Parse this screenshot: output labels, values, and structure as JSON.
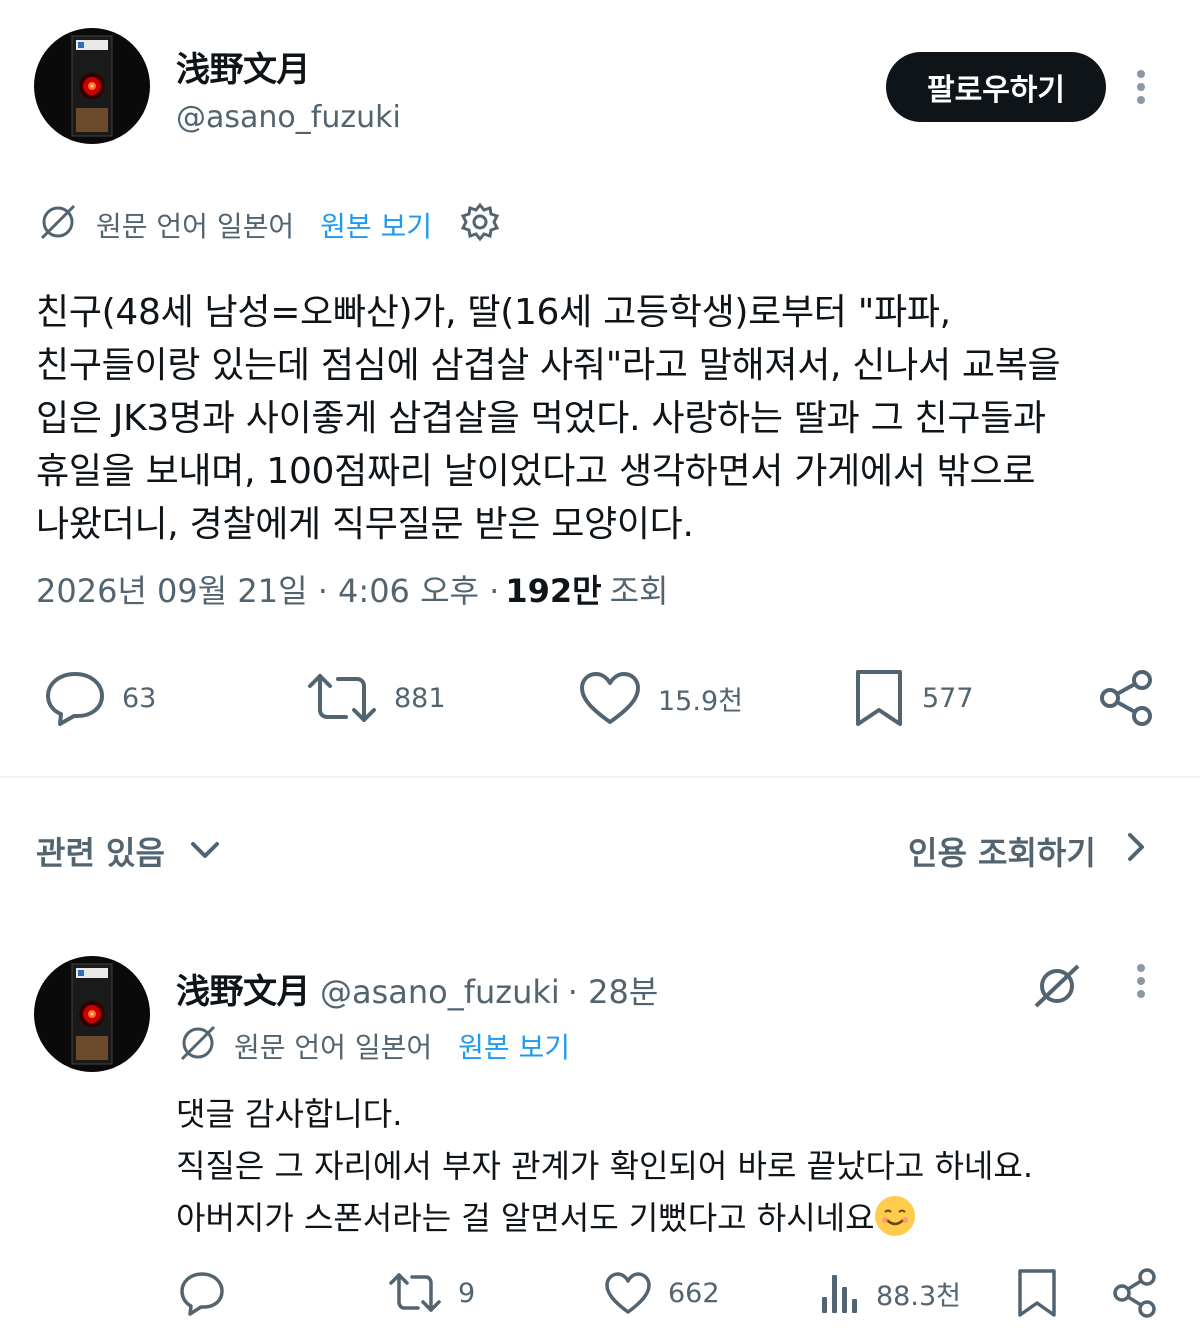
{
  "tweet": {
    "author_name": "浅野文月",
    "author_handle": "@asano_fuzuki",
    "follow_label": "팔로우하기",
    "translation": {
      "language_label": "원문 언어 일본어",
      "show_original_label": "원본 보기"
    },
    "text_lines": [
      "친구(48세 남성=오빠산)가, 딸(16세 고등학생)로부터 \"파파,",
      "친구들이랑 있는데 점심에 삼겹살 사줘\"라고 말해져서, 신나서 교복을",
      "입은 JK3명과 사이좋게 삼겹살을 먹었다. 사랑하는 딸과 그 친구들과",
      "휴일을 보내며, 100점짜리 날이었다고 생각하면서 가게에서 밖으로",
      "나왔더니, 경찰에게 직무질문 받은 모양이다."
    ],
    "timestamp": "2026년 09월 21일 · 4:06 오후 ·",
    "views_count": "192만",
    "views_label": "조회",
    "actions": {
      "replies": "63",
      "retweets": "881",
      "likes": "15.9천",
      "bookmarks": "577"
    }
  },
  "related": {
    "label": "관련 있음",
    "quote_label": "인용 조회하기"
  },
  "reply": {
    "author_name": "浅野文月",
    "author_handle": "@asano_fuzuki",
    "time": "· 28분",
    "translation": {
      "language_label": "원문 언어 일본어",
      "show_original_label": "원본 보기"
    },
    "text_lines": [
      "댓글 감사합니다.",
      "직질은 그 자리에서 부자 관계가 확인되어 바로 끝났다고 하네요.",
      "아버지가 스폰서라는 걸 알면서도 기뻤다고 하시네요"
    ],
    "actions": {
      "retweets": "9",
      "likes": "662",
      "views": "88.3천"
    }
  },
  "colors": {
    "text_primary": "#0f1419",
    "text_secondary": "#536471",
    "accent": "#1d9bf0",
    "divider": "#eff3f4"
  },
  "icons": [
    "translate-icon",
    "gear-icon",
    "reply-icon",
    "retweet-icon",
    "like-icon",
    "bookmark-icon",
    "share-icon",
    "chevron-down-icon",
    "chevron-right-icon",
    "views-icon",
    "more-icon",
    "smile-emoji"
  ]
}
